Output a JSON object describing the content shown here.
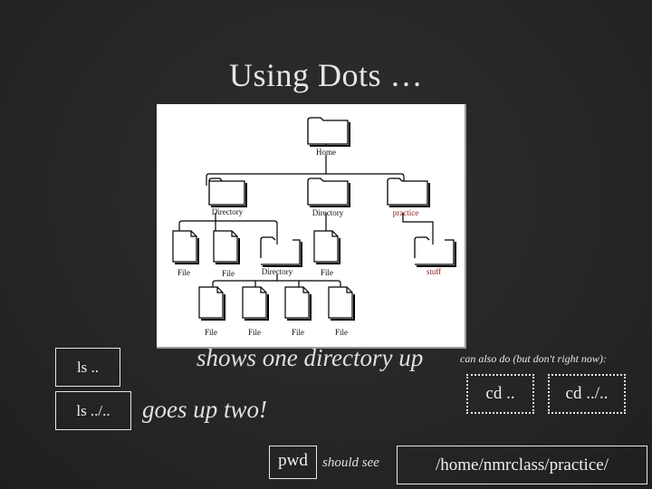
{
  "slide": {
    "title": "Using Dots …"
  },
  "diagram": {
    "root": {
      "label": "Home"
    },
    "level1": [
      {
        "label": "Directory",
        "highlight": false
      },
      {
        "label": "Directory",
        "highlight": false
      },
      {
        "label": "practice",
        "highlight": true
      }
    ],
    "level2": [
      {
        "label": "File",
        "type": "file"
      },
      {
        "label": "File",
        "type": "file"
      },
      {
        "label": "Directory",
        "type": "folder"
      },
      {
        "label": "File",
        "type": "file"
      },
      {
        "label": "stuff",
        "type": "folder",
        "highlight": true
      }
    ],
    "level3": [
      {
        "label": "File",
        "type": "file"
      },
      {
        "label": "File",
        "type": "file"
      },
      {
        "label": "File",
        "type": "file"
      },
      {
        "label": "File",
        "type": "file"
      }
    ],
    "highlight_color": "#8b1a1a"
  },
  "commands": [
    {
      "cmd": "ls  ..",
      "description": "shows one directory up"
    },
    {
      "cmd": "ls  ../..",
      "description": "goes up two!"
    }
  ],
  "note": {
    "text": "can also do (but don't right now):",
    "alternatives": [
      "cd  ..",
      "cd  ../.."
    ]
  },
  "pwd": {
    "cmd": "pwd",
    "connector": "should see",
    "result": "/home/nmrclass/practice/"
  }
}
